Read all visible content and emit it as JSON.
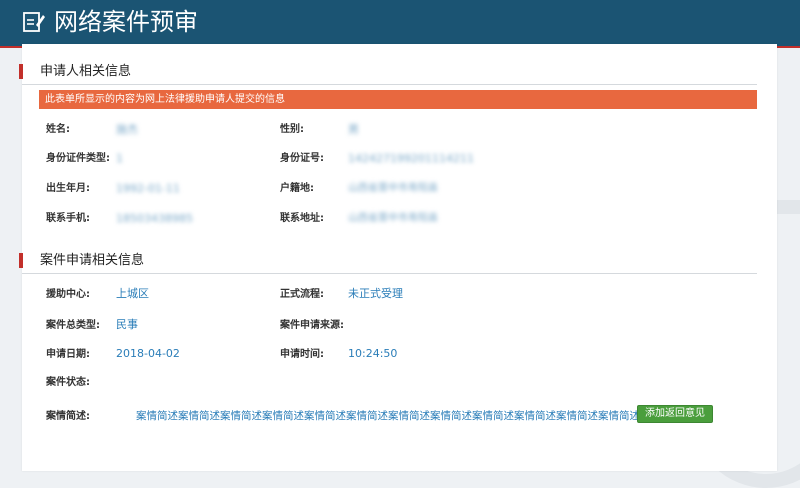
{
  "header": {
    "title": "网络案件预审",
    "icon": "edit-note-icon"
  },
  "applicant_section": {
    "title": "申请人相关信息",
    "notice": "此表单所显示的内容为网上法律援助申请人提交的信息",
    "fields": {
      "name": {
        "label": "姓名:",
        "value": "施杰"
      },
      "gender": {
        "label": "性别:",
        "value": "男"
      },
      "id_type": {
        "label": "身份证件类型:",
        "value": "1"
      },
      "id_number": {
        "label": "身份证号:",
        "value": "142427199201114211"
      },
      "birth": {
        "label": "出生年月:",
        "value": "1992-01-11"
      },
      "hukou": {
        "label": "户籍地:",
        "value": "山西省晋中市寿阳县"
      },
      "phone": {
        "label": "联系手机:",
        "value": "18503438985"
      },
      "address": {
        "label": "联系地址:",
        "value": "山西省晋中市寿阳县"
      }
    }
  },
  "case_section": {
    "title": "案件申请相关信息",
    "fields": {
      "center": {
        "label": "援助中心:",
        "value": "上城区"
      },
      "flow": {
        "label": "正式流程:",
        "value": "未正式受理"
      },
      "case_type": {
        "label": "案件总类型:",
        "value": "民事"
      },
      "source": {
        "label": "案件申请来源:",
        "value": ""
      },
      "apply_date": {
        "label": "申请日期:",
        "value": "2018-04-02"
      },
      "apply_time": {
        "label": "申请时间:",
        "value": "10:24:50"
      },
      "status": {
        "label": "案件状态:",
        "value": ""
      },
      "summary": {
        "label": "案情简述:",
        "value": "案情简述案情简述案情简述案情简述案情简述案情简述案情简述案情简述案情简述案情简述案情简述案情简述"
      }
    },
    "add_feedback_button": "添加返回意见"
  },
  "colors": {
    "header_bg": "#1b5473",
    "accent_red": "#c22f2a",
    "notice_bg": "#e8683f",
    "value_blue": "#2a7db8",
    "button_green": "#4a9e3c"
  }
}
